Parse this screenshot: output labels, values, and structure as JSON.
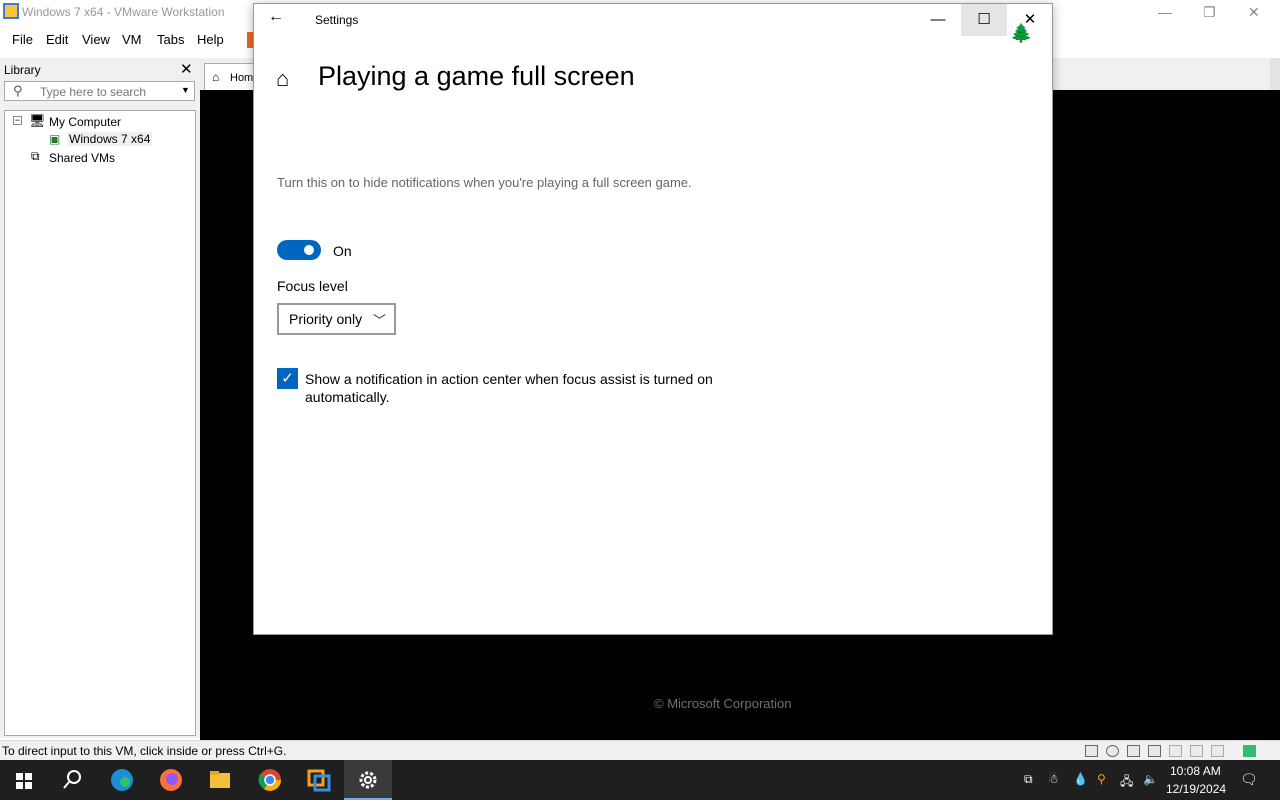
{
  "host": {
    "title": "Windows 7 x64 - VMware Workstation",
    "menu": [
      "File",
      "Edit",
      "View",
      "VM",
      "Tabs",
      "Help"
    ],
    "library": {
      "title": "Library",
      "search_placeholder": "Type here to search",
      "tree": [
        "My Computer",
        "Windows 7 x64",
        "Shared VMs"
      ]
    },
    "tab_home": "Home",
    "status_text": "To direct input to this VM, click inside or press Ctrl+G.",
    "vm_copyright": "© Microsoft Corporation"
  },
  "settings": {
    "window_title": "Settings",
    "page_title": "Playing a game full screen",
    "description": "Turn this on to hide notifications when you're playing a full screen game.",
    "toggle_state": "On",
    "focus_label": "Focus level",
    "focus_value": "Priority only",
    "checkbox_label": "Show a notification in action center when focus assist is turned on automatically.",
    "checkbox_checked": true
  },
  "taskbar": {
    "apps": [
      "start-icon",
      "search-icon",
      "edge-icon",
      "firefox-icon",
      "file-explorer-icon",
      "chrome-icon",
      "vmware-icon",
      "settings-icon"
    ],
    "time": "10:08 AM",
    "date": "12/19/2024"
  },
  "colors": {
    "accent": "#0067c0",
    "taskbar": "#1f1f1f",
    "vm_bg": "#000000"
  }
}
